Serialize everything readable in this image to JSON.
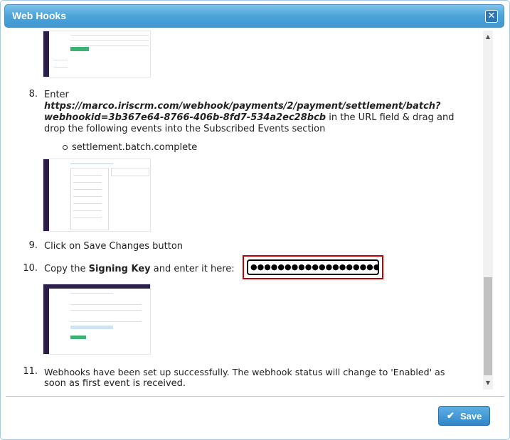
{
  "dialog": {
    "title": "Web Hooks",
    "close_symbol": "✕"
  },
  "steps": {
    "step8": {
      "num": "8.",
      "prefix": "Enter",
      "url": "https://marco.iriscrm.com/webhook/payments/2/payment/settlement/batch?",
      "url2": "webhookid=3b367e64-8766-406b-8fd7-534a2ec28bcb",
      "suffix": " in the URL field & drag and",
      "line3": "drop the following events into the Subscribed Events section",
      "event": "settlement.batch.complete"
    },
    "step9": {
      "num": "9.",
      "text": "Click on Save Changes button"
    },
    "step10": {
      "num": "10.",
      "prefix": "Copy the ",
      "bold": "Signing Key",
      "suffix": " and enter it here:",
      "value": "●●●●●●●●●●●●●●●●●●●●●●●"
    },
    "step11": {
      "num": "11.",
      "line1": "Webhooks have been set up successfully. The webhook status will change to 'Enabled' as",
      "line2": "soon as first event is received."
    }
  },
  "footer": {
    "save_label": "Save",
    "save_icon": "✔"
  },
  "colors": {
    "title_bar": "#4ba3d8",
    "accent_red": "#c00000",
    "save_button": "#2f86c8"
  }
}
